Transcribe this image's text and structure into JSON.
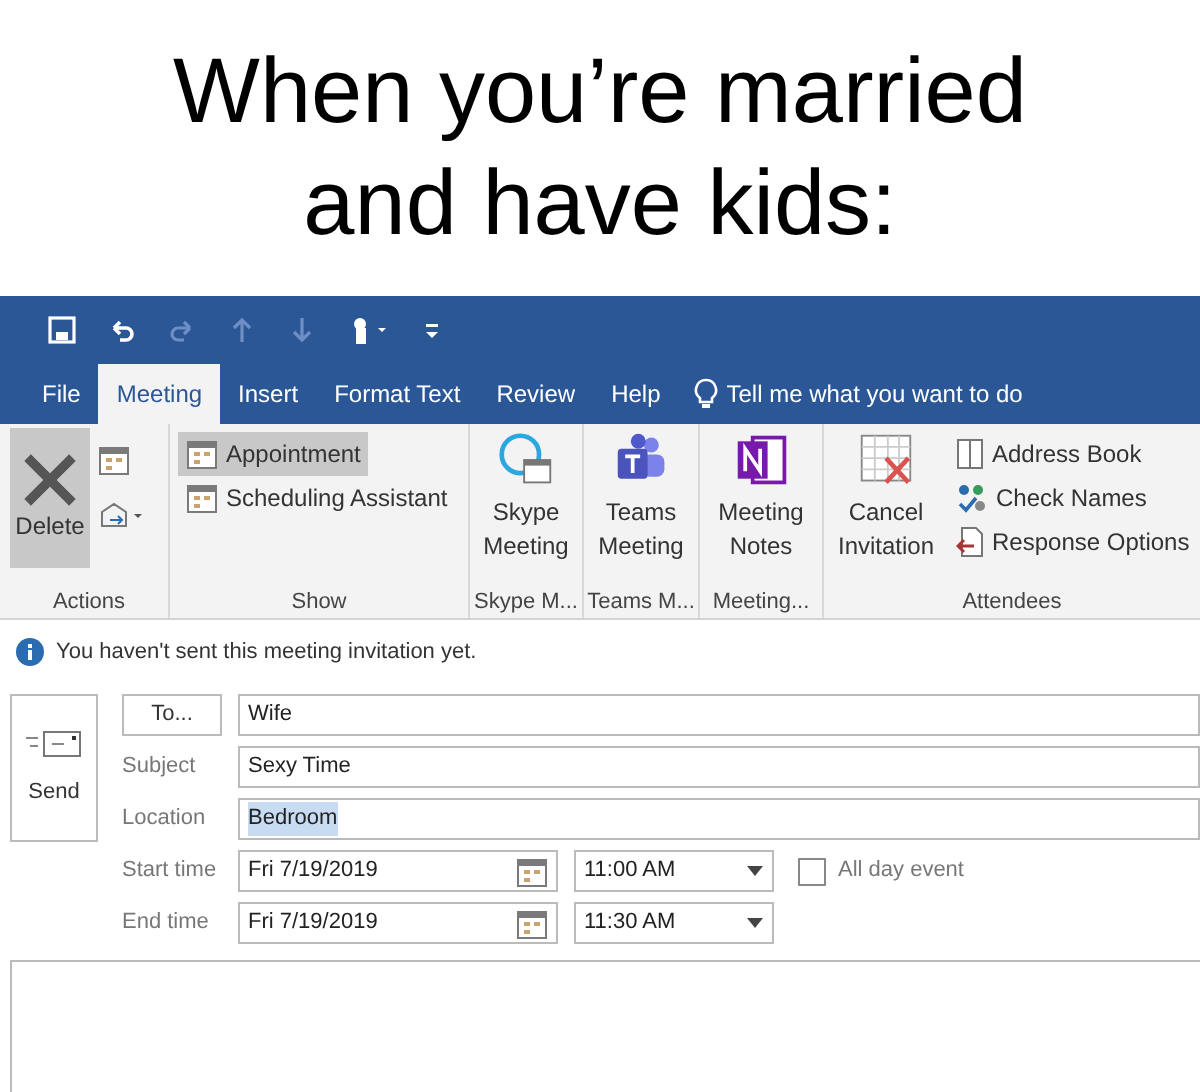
{
  "caption_lines": [
    "When you’re married",
    "and have kids:"
  ],
  "tabs": [
    {
      "label": "File",
      "selected": false
    },
    {
      "label": "Meeting",
      "selected": true
    },
    {
      "label": "Insert",
      "selected": false
    },
    {
      "label": "Format Text",
      "selected": false
    },
    {
      "label": "Review",
      "selected": false
    },
    {
      "label": "Help",
      "selected": false
    }
  ],
  "search": {
    "placeholder": "Tell me what you want to do"
  },
  "ribbon": {
    "groups": [
      {
        "label": "Actions",
        "buttons": [
          {
            "label": "Delete",
            "selected": true
          }
        ]
      },
      {
        "label": "Show",
        "buttons": [
          {
            "label": "Appointment",
            "selected": true
          },
          {
            "label": "Scheduling Assistant",
            "selected": false
          }
        ]
      },
      {
        "label": "Skype M...",
        "buttons": [
          {
            "label": "Skype Meeting",
            "selected": false
          }
        ]
      },
      {
        "label": "Teams M...",
        "buttons": [
          {
            "label": "Teams Meeting",
            "selected": false
          }
        ]
      },
      {
        "label": "Meeting...",
        "buttons": [
          {
            "label": "Meeting Notes",
            "selected": false
          }
        ]
      },
      {
        "label": "Attendees",
        "buttons": [
          {
            "label": "Cancel Invitation",
            "selected": false
          },
          {
            "label": "Address Book",
            "selected": false
          },
          {
            "label": "Check Names",
            "selected": false
          },
          {
            "label": "Response Options",
            "selected": false
          }
        ]
      }
    ]
  },
  "info": "You haven't sent this meeting invitation yet.",
  "send_button": "Send",
  "to_button": "To...",
  "to_value": "Wife",
  "subject": {
    "label": "Subject",
    "value": "Sexy Time"
  },
  "location": {
    "label": "Location",
    "value": "Bedroom",
    "selected": true
  },
  "times": [
    {
      "label": "Start time",
      "date": "Fri 7/19/2019",
      "time": "11:00 AM"
    },
    {
      "label": "End time",
      "date": "Fri 7/19/2019",
      "time": "11:30 AM"
    }
  ],
  "all_day": {
    "label": "All day event",
    "checked": false
  }
}
